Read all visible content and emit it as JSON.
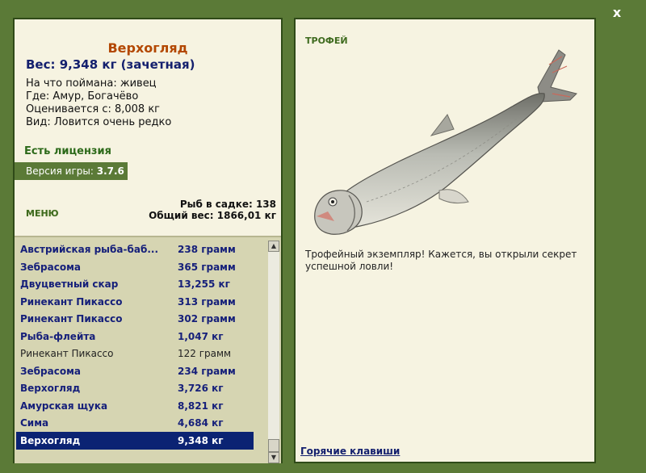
{
  "window": {
    "close_label": "x"
  },
  "fish": {
    "name": "Верхогляд",
    "weight": "Вес: 9,348 кг (зачетная)",
    "bait": "На что поймана: живец",
    "location": "Где: Амур, Богачёво",
    "valued_from": "Оценивается с: 8,008 кг",
    "rarity": "Вид: Ловится очень редко"
  },
  "license": "Есть лицензия",
  "version": {
    "label": "Версия игры:",
    "value": "3.7.6"
  },
  "menu_label": "МЕНЮ",
  "stats": {
    "fish_count": "Рыб в садке: 138",
    "total_weight": "Общий вес: 1866,01 кг"
  },
  "catch_list": [
    {
      "name": "Австрийская рыба-баб...",
      "weight": "238 грамм",
      "style": "bold"
    },
    {
      "name": "Зебрасома",
      "weight": "365 грамм",
      "style": "bold"
    },
    {
      "name": "Двуцветный скар",
      "weight": "13,255 кг",
      "style": "bold"
    },
    {
      "name": "Ринекант Пикассо",
      "weight": "313 грамм",
      "style": "bold"
    },
    {
      "name": "Ринекант Пикассо",
      "weight": "302 грамм",
      "style": "bold"
    },
    {
      "name": "Рыба-флейта",
      "weight": "1,047 кг",
      "style": "bold"
    },
    {
      "name": "Ринекант Пикассо",
      "weight": "122 грамм",
      "style": "plain"
    },
    {
      "name": "Зебрасома",
      "weight": "234 грамм",
      "style": "bold"
    },
    {
      "name": "Верхогляд",
      "weight": "3,726 кг",
      "style": "bold"
    },
    {
      "name": "Амурская щука",
      "weight": "8,821 кг",
      "style": "bold"
    },
    {
      "name": "Сима",
      "weight": "4,684 кг",
      "style": "bold"
    },
    {
      "name": "Верхогляд",
      "weight": "9,348 кг",
      "style": "selected"
    }
  ],
  "trophy": {
    "title": "ТРОФЕЙ",
    "text": "Трофейный экземпляр! Кажется, вы открыли секрет успешной ловли!"
  },
  "hotkeys_label": "Горячие клавиши",
  "colors": {
    "frame": "#5b7a37",
    "panel_bg": "#f6f3e1",
    "list_bg": "#d6d5b2",
    "selected_row": "#0b2373",
    "fish_name": "#b34700",
    "link_blue": "#14206e"
  }
}
